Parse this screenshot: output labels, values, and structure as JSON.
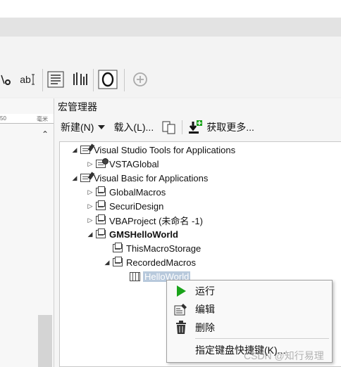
{
  "toolbar": {
    "text_tool_label": "ab",
    "icons": [
      "shape-edit-icon",
      "text-tool-icon",
      "paragraph-format-icon",
      "columns-format-icon",
      "outline-icon",
      "add-icon"
    ]
  },
  "ruler": {
    "tick_label": "50",
    "unit_label": "毫米"
  },
  "panel": {
    "title": "宏管理器",
    "new_label": "新建(N)",
    "load_label": "载入(L)...",
    "get_more_label": "获取更多..."
  },
  "tree": {
    "vsta": "Visual Studio Tools for Applications",
    "vstaglobal": "VSTAGlobal",
    "vba": "Visual Basic for Applications",
    "globalmacros": "GlobalMacros",
    "securidesign": "SecuriDesign",
    "vbaproject": "VBAProject (未命名 -1)",
    "gmshello": "GMSHelloWorld",
    "thismacro": "ThisMacroStorage",
    "recorded": "RecordedMacros",
    "helloworld": "HelloWorld"
  },
  "context_menu": {
    "run": "运行",
    "edit": "编辑",
    "delete": "删除",
    "assign_shortcut": "指定键盘快捷键(K)..."
  },
  "watermark": "CSDN @知行易理",
  "colors": {
    "run_green": "#1aa31a",
    "get_more_red": "#d42020"
  }
}
